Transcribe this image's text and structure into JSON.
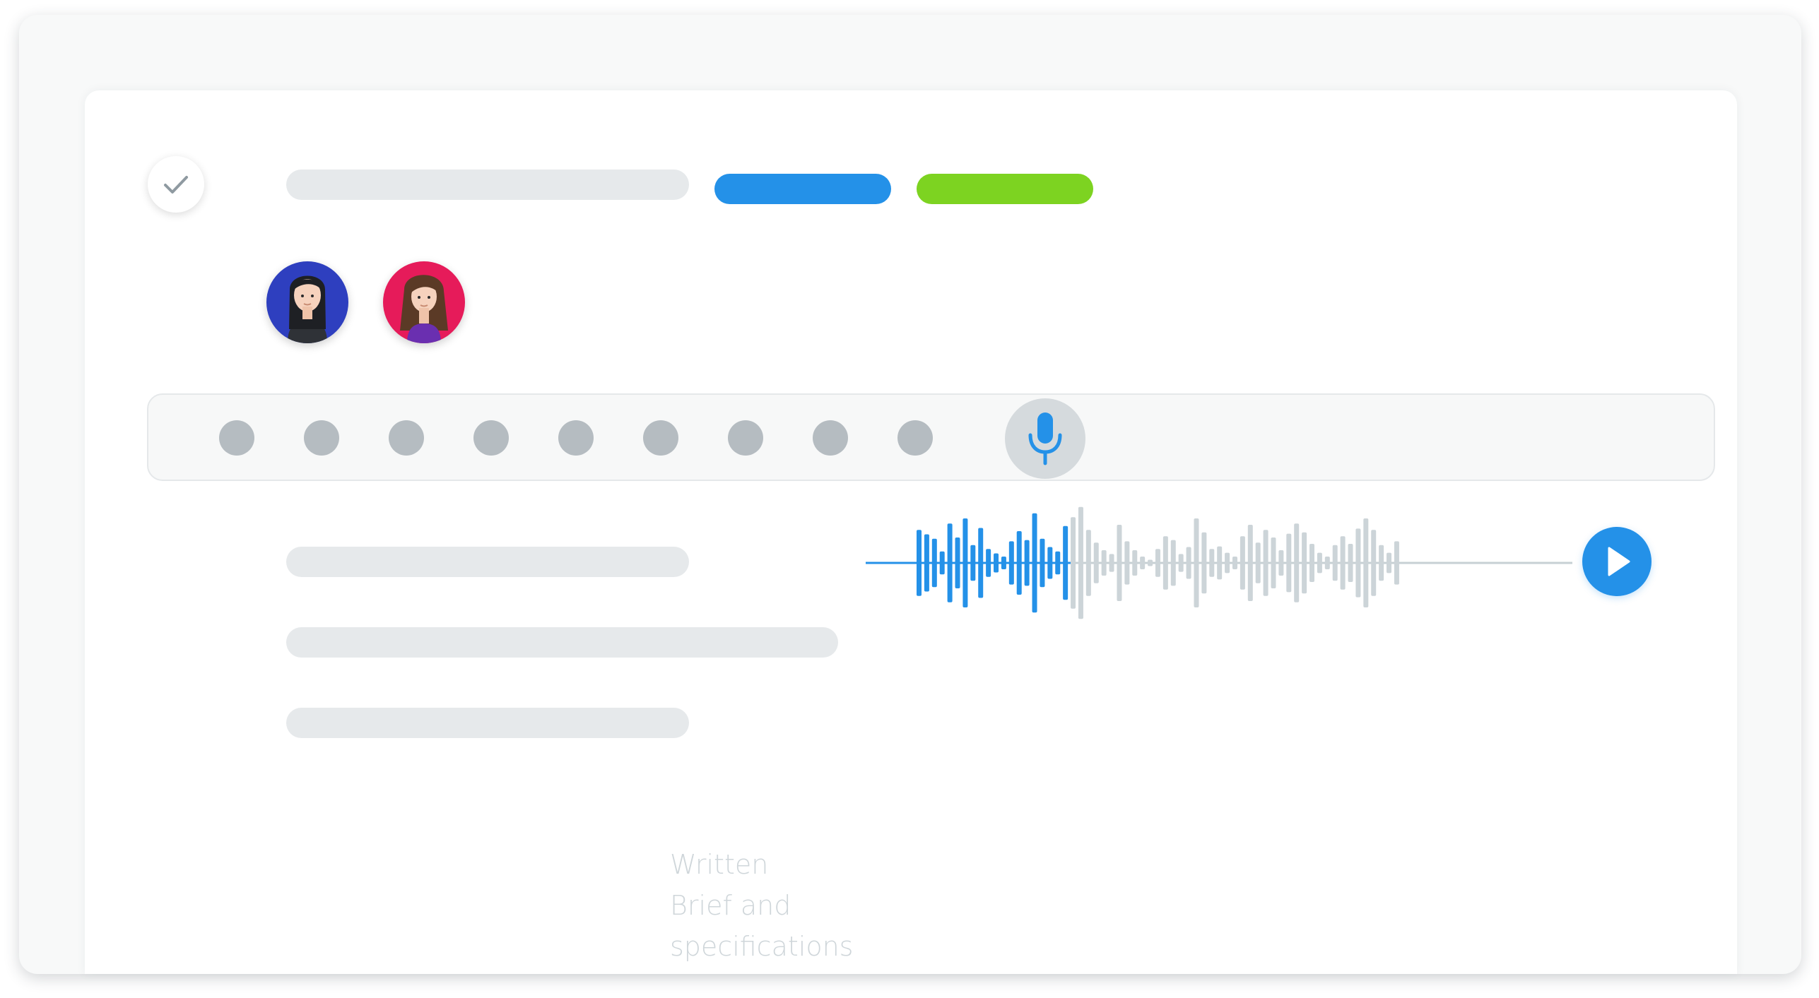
{
  "colors": {
    "accent_blue": "#2491e8",
    "accent_green": "#7dd321",
    "placeholder_gray": "#e6e9eb",
    "dot_gray": "#b5bcc1",
    "wave_gray": "#ccd4d8"
  },
  "task": {
    "status_icon": "check-icon",
    "tags": [
      {
        "name": "tag-blue",
        "color": "#2491e8"
      },
      {
        "name": "tag-green",
        "color": "#7dd321"
      }
    ]
  },
  "assignees": [
    {
      "name": "avatar-1",
      "background": "#2e3fbf"
    },
    {
      "name": "avatar-2",
      "background": "#e61b5a"
    }
  ],
  "recorder": {
    "mic_icon": "microphone-icon",
    "dot_count": 9
  },
  "audio": {
    "play_icon": "play-icon",
    "progress": 0.31
  },
  "caption": {
    "line1": "Written",
    "line2": "Brief and",
    "line3": "specifications"
  }
}
